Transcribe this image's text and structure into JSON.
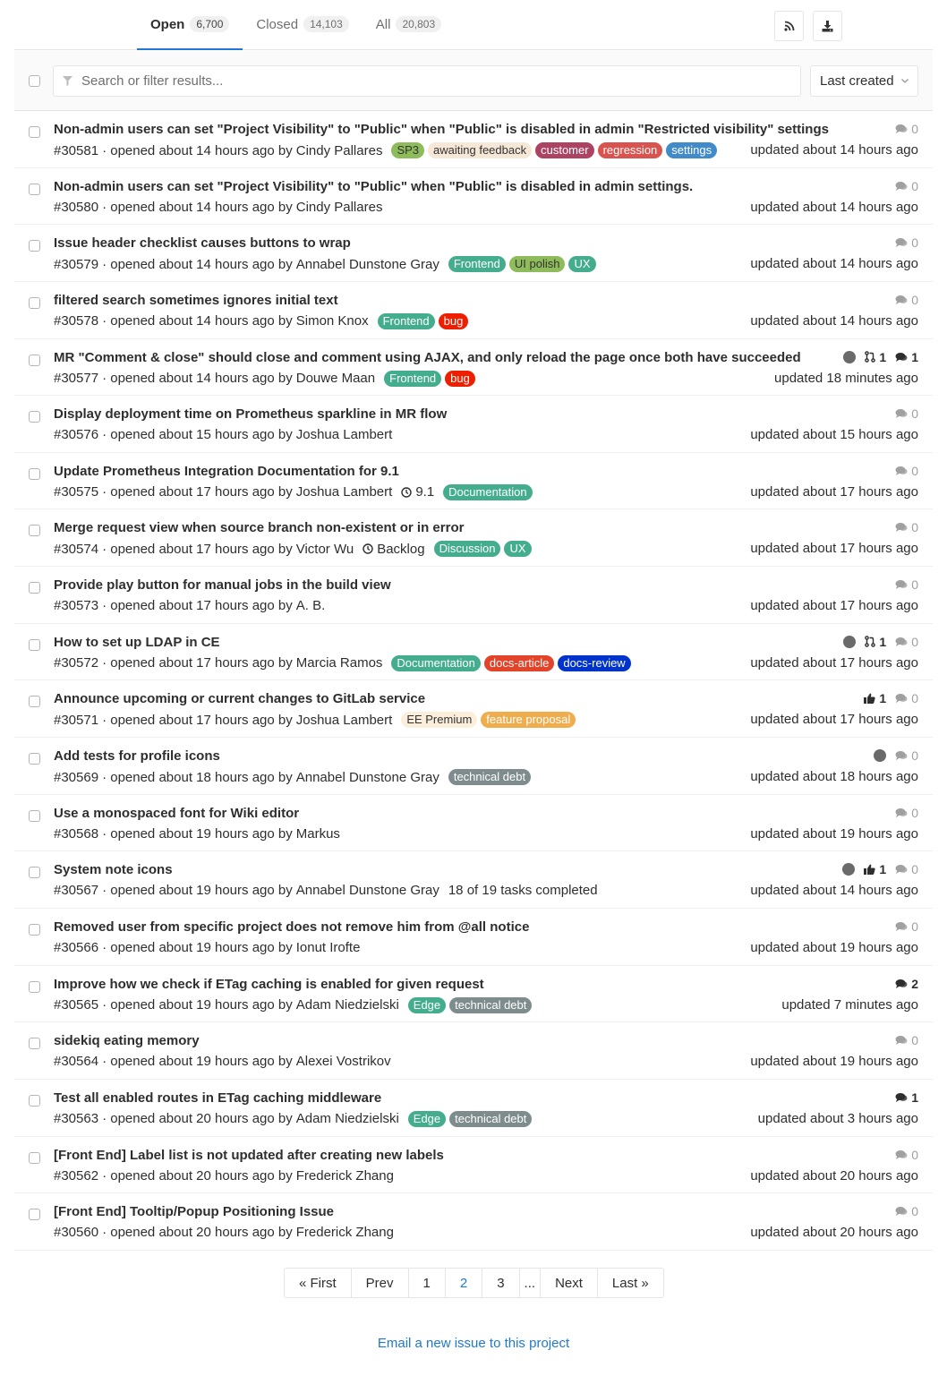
{
  "tabs": [
    {
      "label": "Open",
      "count": "6,700"
    },
    {
      "label": "Closed",
      "count": "14,103"
    },
    {
      "label": "All",
      "count": "20,803"
    }
  ],
  "search": {
    "placeholder": "Search or filter results..."
  },
  "sort": {
    "label": "Last created"
  },
  "issues": [
    {
      "title": "Non-admin users can set \"Project Visibility\" to \"Public\" when \"Public\" is disabled in admin \"Restricted visibility\" settings",
      "ref": "#30581",
      "opened": "· opened about 14 hours ago by",
      "author": "Cindy Pallares",
      "extra": "",
      "labels": [
        {
          "text": "SP3",
          "bg": "#8fbc5a",
          "fg": "#333333"
        },
        {
          "text": "awaiting feedback",
          "bg": "#f7e7d6",
          "fg": "#333333"
        },
        {
          "text": "customer",
          "bg": "#ad4363",
          "fg": "#ffffff"
        },
        {
          "text": "regression",
          "bg": "#d9534f",
          "fg": "#ffffff"
        },
        {
          "text": "settings",
          "bg": "#428bca",
          "fg": "#ffffff"
        }
      ],
      "stats": [
        {
          "type": "comment",
          "value": "0",
          "dark": false
        }
      ],
      "avatar": false,
      "updated": "updated about 14 hours ago"
    },
    {
      "title": "Non-admin users can set \"Project Visibility\" to \"Public\" when \"Public\" is disabled in admin settings.",
      "ref": "#30580",
      "opened": "· opened about 14 hours ago by",
      "author": "Cindy Pallares",
      "extra": "",
      "labels": [],
      "stats": [
        {
          "type": "comment",
          "value": "0",
          "dark": false
        }
      ],
      "avatar": false,
      "updated": "updated about 14 hours ago"
    },
    {
      "title": "Issue header checklist causes buttons to wrap",
      "ref": "#30579",
      "opened": "· opened about 14 hours ago by",
      "author": "Annabel Dunstone Gray",
      "extra": "",
      "labels": [
        {
          "text": "Frontend",
          "bg": "#44ad8e",
          "fg": "#ffffff"
        },
        {
          "text": "UI polish",
          "bg": "#8fbc5a",
          "fg": "#333333"
        },
        {
          "text": "UX",
          "bg": "#44ad8e",
          "fg": "#ffffff"
        }
      ],
      "stats": [
        {
          "type": "comment",
          "value": "0",
          "dark": false
        }
      ],
      "avatar": false,
      "updated": "updated about 14 hours ago"
    },
    {
      "title": "filtered search sometimes ignores initial text",
      "ref": "#30578",
      "opened": "· opened about 14 hours ago by",
      "author": "Simon Knox",
      "extra": "",
      "labels": [
        {
          "text": "Frontend",
          "bg": "#44ad8e",
          "fg": "#ffffff"
        },
        {
          "text": "bug",
          "bg": "#ee1f00",
          "fg": "#ffffff"
        }
      ],
      "stats": [
        {
          "type": "comment",
          "value": "0",
          "dark": false
        }
      ],
      "avatar": false,
      "updated": "updated about 14 hours ago"
    },
    {
      "title": "MR \"Comment & close\" should close and comment using AJAX, and only reload the page once both have succeeded",
      "ref": "#30577",
      "opened": "· opened about 14 hours ago by",
      "author": "Douwe Maan",
      "extra": "",
      "labels": [
        {
          "text": "Frontend",
          "bg": "#44ad8e",
          "fg": "#ffffff"
        },
        {
          "text": "bug",
          "bg": "#ee1f00",
          "fg": "#ffffff"
        }
      ],
      "stats": [
        {
          "type": "mr",
          "value": "1",
          "dark": true
        },
        {
          "type": "comment",
          "value": "1",
          "dark": true
        }
      ],
      "avatar": true,
      "updated": "updated 18 minutes ago"
    },
    {
      "title": "Display deployment time on Prometheus sparkline in MR flow",
      "ref": "#30576",
      "opened": "· opened about 15 hours ago by",
      "author": "Joshua Lambert",
      "extra": "",
      "labels": [],
      "stats": [
        {
          "type": "comment",
          "value": "0",
          "dark": false
        }
      ],
      "avatar": false,
      "updated": "updated about 15 hours ago"
    },
    {
      "title": "Update Prometheus Integration Documentation for 9.1",
      "ref": "#30575",
      "opened": "· opened about 17 hours ago by",
      "author": "Joshua Lambert",
      "extra": "9.1",
      "labels": [
        {
          "text": "Documentation",
          "bg": "#44ad8e",
          "fg": "#ffffff"
        }
      ],
      "stats": [
        {
          "type": "comment",
          "value": "0",
          "dark": false
        }
      ],
      "avatar": false,
      "updated": "updated about 17 hours ago"
    },
    {
      "title": "Merge request view when source branch non-existent or in error",
      "ref": "#30574",
      "opened": "· opened about 17 hours ago by",
      "author": "Victor Wu",
      "extra": "Backlog",
      "labels": [
        {
          "text": "Discussion",
          "bg": "#44ad8e",
          "fg": "#ffffff"
        },
        {
          "text": "UX",
          "bg": "#44ad8e",
          "fg": "#ffffff"
        }
      ],
      "stats": [
        {
          "type": "comment",
          "value": "0",
          "dark": false
        }
      ],
      "avatar": false,
      "updated": "updated about 17 hours ago"
    },
    {
      "title": "Provide play button for manual jobs in the build view",
      "ref": "#30573",
      "opened": "· opened about 17 hours ago by",
      "author": "A. B.",
      "extra": "",
      "labels": [],
      "stats": [
        {
          "type": "comment",
          "value": "0",
          "dark": false
        }
      ],
      "avatar": false,
      "updated": "updated about 17 hours ago"
    },
    {
      "title": "How to set up LDAP in CE",
      "ref": "#30572",
      "opened": "· opened about 17 hours ago by",
      "author": "Marcia Ramos",
      "extra": "",
      "labels": [
        {
          "text": "Documentation",
          "bg": "#44ad8e",
          "fg": "#ffffff"
        },
        {
          "text": "docs-article",
          "bg": "#e24329",
          "fg": "#ffffff"
        },
        {
          "text": "docs-review",
          "bg": "#0033cc",
          "fg": "#ffffff"
        }
      ],
      "stats": [
        {
          "type": "mr",
          "value": "1",
          "dark": true
        },
        {
          "type": "comment",
          "value": "0",
          "dark": false
        }
      ],
      "avatar": true,
      "updated": "updated about 17 hours ago"
    },
    {
      "title": "Announce upcoming or current changes to GitLab service",
      "ref": "#30571",
      "opened": "· opened about 17 hours ago by",
      "author": "Joshua Lambert",
      "extra": "",
      "labels": [
        {
          "text": "EE Premium",
          "bg": "#fbeedb",
          "fg": "#333333"
        },
        {
          "text": "feature proposal",
          "bg": "#f0ad4e",
          "fg": "#ffffff"
        }
      ],
      "stats": [
        {
          "type": "thumb",
          "value": "1",
          "dark": true
        },
        {
          "type": "comment",
          "value": "0",
          "dark": false
        }
      ],
      "avatar": false,
      "updated": "updated about 17 hours ago"
    },
    {
      "title": "Add tests for profile icons",
      "ref": "#30569",
      "opened": "· opened about 18 hours ago by",
      "author": "Annabel Dunstone Gray",
      "extra": "",
      "labels": [
        {
          "text": "technical debt",
          "bg": "#7f8c8d",
          "fg": "#ffffff"
        }
      ],
      "stats": [
        {
          "type": "comment",
          "value": "0",
          "dark": false
        }
      ],
      "avatar": true,
      "updated": "updated about 18 hours ago"
    },
    {
      "title": "Use a monospaced font for Wiki editor",
      "ref": "#30568",
      "opened": "· opened about 19 hours ago by",
      "author": "Markus",
      "extra": "",
      "labels": [],
      "stats": [
        {
          "type": "comment",
          "value": "0",
          "dark": false
        }
      ],
      "avatar": false,
      "updated": "updated about 19 hours ago"
    },
    {
      "title": "System note icons",
      "ref": "#30567",
      "opened": "· opened about 19 hours ago by",
      "author": "Annabel Dunstone Gray",
      "extra": "18 of 19 tasks completed",
      "labels": [],
      "stats": [
        {
          "type": "thumb",
          "value": "1",
          "dark": true
        },
        {
          "type": "comment",
          "value": "0",
          "dark": false
        }
      ],
      "avatar": true,
      "updated": "updated about 14 hours ago"
    },
    {
      "title": "Removed user from specific project does not remove him from @all notice",
      "ref": "#30566",
      "opened": "· opened about 19 hours ago by",
      "author": "Ionut Irofte",
      "extra": "",
      "labels": [],
      "stats": [
        {
          "type": "comment",
          "value": "0",
          "dark": false
        }
      ],
      "avatar": false,
      "updated": "updated about 19 hours ago"
    },
    {
      "title": "Improve how we check if ETag caching is enabled for given request",
      "ref": "#30565",
      "opened": "· opened about 19 hours ago by",
      "author": "Adam Niedzielski",
      "extra": "",
      "labels": [
        {
          "text": "Edge",
          "bg": "#44ad8e",
          "fg": "#ffffff"
        },
        {
          "text": "technical debt",
          "bg": "#7f8c8d",
          "fg": "#ffffff"
        }
      ],
      "stats": [
        {
          "type": "comment",
          "value": "2",
          "dark": true
        }
      ],
      "avatar": false,
      "updated": "updated 7 minutes ago"
    },
    {
      "title": "sidekiq eating memory",
      "ref": "#30564",
      "opened": "· opened about 19 hours ago by",
      "author": "Alexei Vostrikov",
      "extra": "",
      "labels": [],
      "stats": [
        {
          "type": "comment",
          "value": "0",
          "dark": false
        }
      ],
      "avatar": false,
      "updated": "updated about 19 hours ago"
    },
    {
      "title": "Test all enabled routes in ETag caching middleware",
      "ref": "#30563",
      "opened": "· opened about 20 hours ago by",
      "author": "Adam Niedzielski",
      "extra": "",
      "labels": [
        {
          "text": "Edge",
          "bg": "#44ad8e",
          "fg": "#ffffff"
        },
        {
          "text": "technical debt",
          "bg": "#7f8c8d",
          "fg": "#ffffff"
        }
      ],
      "stats": [
        {
          "type": "comment",
          "value": "1",
          "dark": true
        }
      ],
      "avatar": false,
      "updated": "updated about 3 hours ago"
    },
    {
      "title": "[Front End] Label list is not updated after creating new labels",
      "ref": "#30562",
      "opened": "· opened about 20 hours ago by",
      "author": "Frederick Zhang",
      "extra": "",
      "labels": [],
      "stats": [
        {
          "type": "comment",
          "value": "0",
          "dark": false
        }
      ],
      "avatar": false,
      "updated": "updated about 20 hours ago"
    },
    {
      "title": "[Front End] Tooltip/Popup Positioning Issue",
      "ref": "#30560",
      "opened": "· opened about 20 hours ago by",
      "author": "Frederick Zhang",
      "extra": "",
      "labels": [],
      "stats": [
        {
          "type": "comment",
          "value": "0",
          "dark": false
        }
      ],
      "avatar": false,
      "updated": "updated about 20 hours ago"
    }
  ],
  "pagination": {
    "first": "« First",
    "prev": "Prev",
    "pages": [
      "1",
      "2",
      "3"
    ],
    "active_page": "2",
    "ellipsis": "...",
    "next": "Next",
    "last": "Last »"
  },
  "footer": {
    "email_link": "Email a new issue to this project"
  },
  "colors": {
    "accent": "#1f78d1",
    "border": "#e5e5e5",
    "muted": "#707070"
  }
}
